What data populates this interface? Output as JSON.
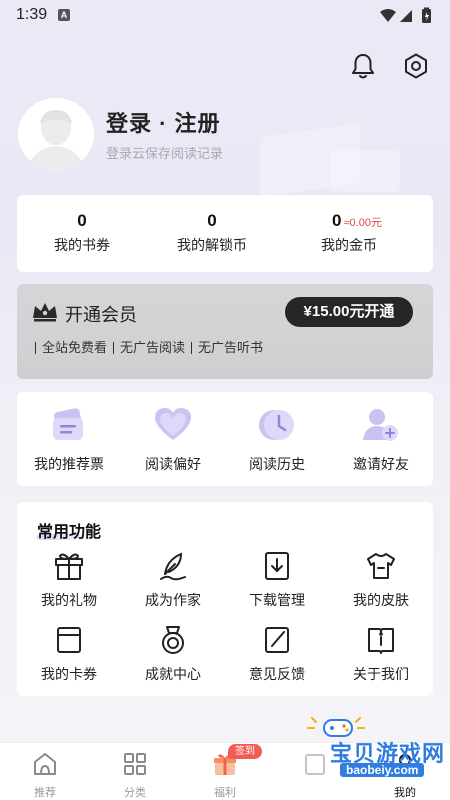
{
  "status_bar": {
    "time": "1:39",
    "notif_glyph": "A"
  },
  "profile": {
    "title": "登录 · 注册",
    "subtitle": "登录云保存阅读记录"
  },
  "currency": [
    {
      "value": "0",
      "label": "我的书券"
    },
    {
      "value": "0",
      "label": "我的解锁币"
    },
    {
      "value": "0",
      "sub": "≈0.00元",
      "label": "我的金币"
    }
  ],
  "vip": {
    "title": "开通会员",
    "button": "¥15.00元开通",
    "features": [
      "全站免费看",
      "无广告阅读",
      "无广告听书"
    ]
  },
  "quick": [
    {
      "label": "我的推荐票",
      "icon": "ticket-icon"
    },
    {
      "label": "阅读偏好",
      "icon": "heart-icon"
    },
    {
      "label": "阅读历史",
      "icon": "clock-icon"
    },
    {
      "label": "邀请好友",
      "icon": "invite-user-icon"
    }
  ],
  "functions": {
    "title": "常用功能",
    "items": [
      {
        "label": "我的礼物",
        "icon": "gift-icon"
      },
      {
        "label": "成为作家",
        "icon": "quill-icon"
      },
      {
        "label": "下载管理",
        "icon": "download-icon"
      },
      {
        "label": "我的皮肤",
        "icon": "tshirt-icon"
      },
      {
        "label": "我的卡券",
        "icon": "card-icon"
      },
      {
        "label": "成就中心",
        "icon": "medal-icon"
      },
      {
        "label": "意见反馈",
        "icon": "edit-icon"
      },
      {
        "label": "关于我们",
        "icon": "info-icon"
      }
    ]
  },
  "nav": {
    "items": [
      {
        "label": "推荐",
        "icon": "home-icon"
      },
      {
        "label": "分类",
        "icon": "grid-icon"
      },
      {
        "label": "福利",
        "icon": "gift-box-icon"
      },
      {
        "label": "",
        "icon": "bookshelf-icon"
      },
      {
        "label": "我的",
        "icon": "profile-icon"
      }
    ],
    "badge": "签到",
    "active_index": 4
  },
  "watermark": {
    "text": "宝贝游戏网",
    "url": "baobeiy.com"
  },
  "colors": {
    "accent": "#b8b0ea",
    "badge": "#f25c54",
    "vip_button": "#262626",
    "gold_sub": "#e24a4a"
  }
}
